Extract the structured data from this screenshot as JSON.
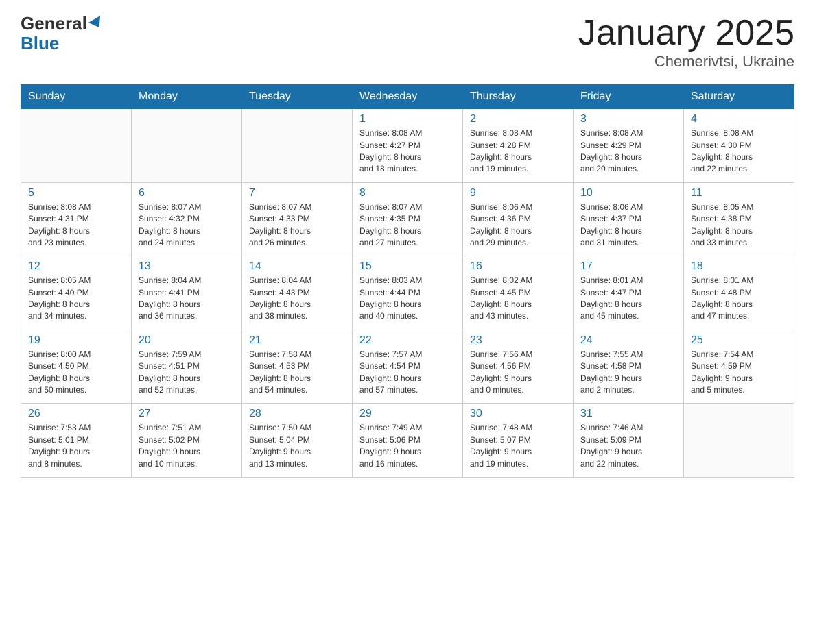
{
  "header": {
    "logo_general": "General",
    "logo_blue": "Blue",
    "title": "January 2025",
    "subtitle": "Chemerivtsi, Ukraine"
  },
  "weekdays": [
    "Sunday",
    "Monday",
    "Tuesday",
    "Wednesday",
    "Thursday",
    "Friday",
    "Saturday"
  ],
  "weeks": [
    [
      {
        "day": "",
        "info": ""
      },
      {
        "day": "",
        "info": ""
      },
      {
        "day": "",
        "info": ""
      },
      {
        "day": "1",
        "info": "Sunrise: 8:08 AM\nSunset: 4:27 PM\nDaylight: 8 hours\nand 18 minutes."
      },
      {
        "day": "2",
        "info": "Sunrise: 8:08 AM\nSunset: 4:28 PM\nDaylight: 8 hours\nand 19 minutes."
      },
      {
        "day": "3",
        "info": "Sunrise: 8:08 AM\nSunset: 4:29 PM\nDaylight: 8 hours\nand 20 minutes."
      },
      {
        "day": "4",
        "info": "Sunrise: 8:08 AM\nSunset: 4:30 PM\nDaylight: 8 hours\nand 22 minutes."
      }
    ],
    [
      {
        "day": "5",
        "info": "Sunrise: 8:08 AM\nSunset: 4:31 PM\nDaylight: 8 hours\nand 23 minutes."
      },
      {
        "day": "6",
        "info": "Sunrise: 8:07 AM\nSunset: 4:32 PM\nDaylight: 8 hours\nand 24 minutes."
      },
      {
        "day": "7",
        "info": "Sunrise: 8:07 AM\nSunset: 4:33 PM\nDaylight: 8 hours\nand 26 minutes."
      },
      {
        "day": "8",
        "info": "Sunrise: 8:07 AM\nSunset: 4:35 PM\nDaylight: 8 hours\nand 27 minutes."
      },
      {
        "day": "9",
        "info": "Sunrise: 8:06 AM\nSunset: 4:36 PM\nDaylight: 8 hours\nand 29 minutes."
      },
      {
        "day": "10",
        "info": "Sunrise: 8:06 AM\nSunset: 4:37 PM\nDaylight: 8 hours\nand 31 minutes."
      },
      {
        "day": "11",
        "info": "Sunrise: 8:05 AM\nSunset: 4:38 PM\nDaylight: 8 hours\nand 33 minutes."
      }
    ],
    [
      {
        "day": "12",
        "info": "Sunrise: 8:05 AM\nSunset: 4:40 PM\nDaylight: 8 hours\nand 34 minutes."
      },
      {
        "day": "13",
        "info": "Sunrise: 8:04 AM\nSunset: 4:41 PM\nDaylight: 8 hours\nand 36 minutes."
      },
      {
        "day": "14",
        "info": "Sunrise: 8:04 AM\nSunset: 4:43 PM\nDaylight: 8 hours\nand 38 minutes."
      },
      {
        "day": "15",
        "info": "Sunrise: 8:03 AM\nSunset: 4:44 PM\nDaylight: 8 hours\nand 40 minutes."
      },
      {
        "day": "16",
        "info": "Sunrise: 8:02 AM\nSunset: 4:45 PM\nDaylight: 8 hours\nand 43 minutes."
      },
      {
        "day": "17",
        "info": "Sunrise: 8:01 AM\nSunset: 4:47 PM\nDaylight: 8 hours\nand 45 minutes."
      },
      {
        "day": "18",
        "info": "Sunrise: 8:01 AM\nSunset: 4:48 PM\nDaylight: 8 hours\nand 47 minutes."
      }
    ],
    [
      {
        "day": "19",
        "info": "Sunrise: 8:00 AM\nSunset: 4:50 PM\nDaylight: 8 hours\nand 50 minutes."
      },
      {
        "day": "20",
        "info": "Sunrise: 7:59 AM\nSunset: 4:51 PM\nDaylight: 8 hours\nand 52 minutes."
      },
      {
        "day": "21",
        "info": "Sunrise: 7:58 AM\nSunset: 4:53 PM\nDaylight: 8 hours\nand 54 minutes."
      },
      {
        "day": "22",
        "info": "Sunrise: 7:57 AM\nSunset: 4:54 PM\nDaylight: 8 hours\nand 57 minutes."
      },
      {
        "day": "23",
        "info": "Sunrise: 7:56 AM\nSunset: 4:56 PM\nDaylight: 9 hours\nand 0 minutes."
      },
      {
        "day": "24",
        "info": "Sunrise: 7:55 AM\nSunset: 4:58 PM\nDaylight: 9 hours\nand 2 minutes."
      },
      {
        "day": "25",
        "info": "Sunrise: 7:54 AM\nSunset: 4:59 PM\nDaylight: 9 hours\nand 5 minutes."
      }
    ],
    [
      {
        "day": "26",
        "info": "Sunrise: 7:53 AM\nSunset: 5:01 PM\nDaylight: 9 hours\nand 8 minutes."
      },
      {
        "day": "27",
        "info": "Sunrise: 7:51 AM\nSunset: 5:02 PM\nDaylight: 9 hours\nand 10 minutes."
      },
      {
        "day": "28",
        "info": "Sunrise: 7:50 AM\nSunset: 5:04 PM\nDaylight: 9 hours\nand 13 minutes."
      },
      {
        "day": "29",
        "info": "Sunrise: 7:49 AM\nSunset: 5:06 PM\nDaylight: 9 hours\nand 16 minutes."
      },
      {
        "day": "30",
        "info": "Sunrise: 7:48 AM\nSunset: 5:07 PM\nDaylight: 9 hours\nand 19 minutes."
      },
      {
        "day": "31",
        "info": "Sunrise: 7:46 AM\nSunset: 5:09 PM\nDaylight: 9 hours\nand 22 minutes."
      },
      {
        "day": "",
        "info": ""
      }
    ]
  ]
}
